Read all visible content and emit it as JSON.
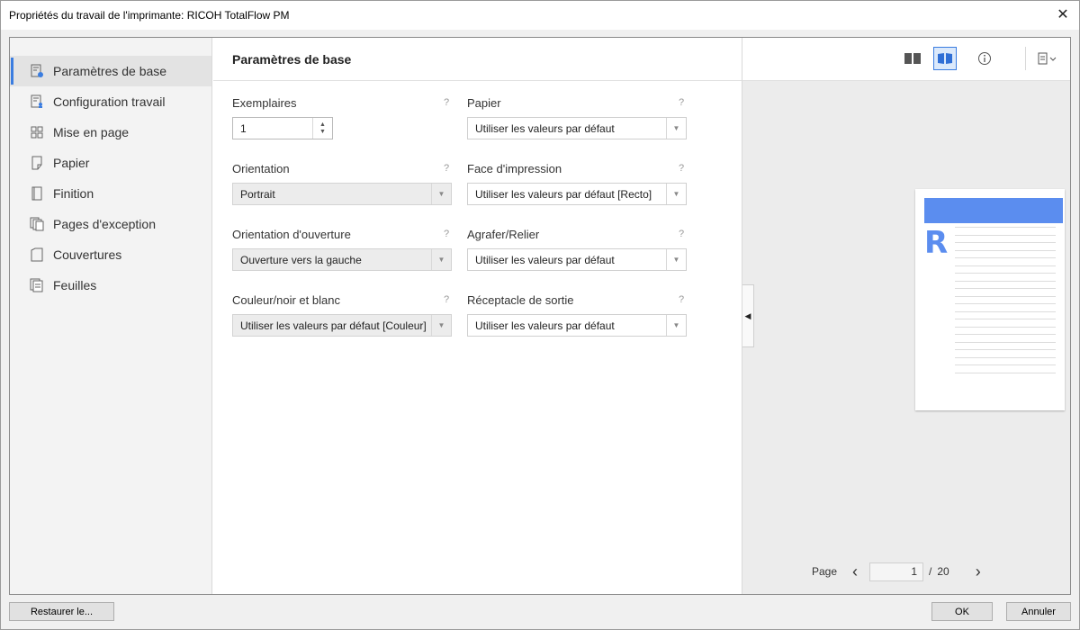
{
  "window": {
    "title": "Propriétés du travail de l'imprimante: RICOH TotalFlow PM",
    "close_glyph": "✕"
  },
  "sidebar": {
    "items": [
      {
        "label": "Paramètres de base",
        "icon": "basic-settings-icon"
      },
      {
        "label": "Configuration travail",
        "icon": "job-setup-icon"
      },
      {
        "label": "Mise en page",
        "icon": "layout-icon"
      },
      {
        "label": "Papier",
        "icon": "paper-icon"
      },
      {
        "label": "Finition",
        "icon": "finishing-icon"
      },
      {
        "label": "Pages d'exception",
        "icon": "exception-pages-icon"
      },
      {
        "label": "Couvertures",
        "icon": "covers-icon"
      },
      {
        "label": "Feuilles",
        "icon": "sheets-icon"
      }
    ],
    "active_index": 0
  },
  "main": {
    "title": "Paramètres de base",
    "help_glyph": "?",
    "fields": {
      "copies": {
        "label": "Exemplaires",
        "value": "1"
      },
      "paper": {
        "label": "Papier",
        "value": "Utiliser les valeurs par défaut"
      },
      "orientation": {
        "label": "Orientation",
        "value": "Portrait"
      },
      "print_side": {
        "label": "Face d'impression",
        "value": "Utiliser les valeurs par défaut [Recto]"
      },
      "opening_orientation": {
        "label": "Orientation d'ouverture",
        "value": "Ouverture vers la gauche"
      },
      "staple_bind": {
        "label": "Agrafer/Relier",
        "value": "Utiliser les valeurs par défaut"
      },
      "color_bw": {
        "label": "Couleur/noir et blanc",
        "value": "Utiliser les valeurs par défaut [Couleur]"
      },
      "output_tray": {
        "label": "Réceptacle de sortie",
        "value": "Utiliser les valeurs par défaut"
      }
    }
  },
  "preview": {
    "toolbar": [
      "two-page-view-icon",
      "book-view-icon",
      "info-icon",
      "print-menu-icon"
    ],
    "pager": {
      "label": "Page",
      "current": "1",
      "separator": "/",
      "total": "20"
    },
    "logo_letter": "R",
    "colors": {
      "accent": "#5b8def"
    }
  },
  "footer": {
    "restore_label": "Restaurer le...",
    "ok_label": "OK",
    "cancel_label": "Annuler"
  }
}
